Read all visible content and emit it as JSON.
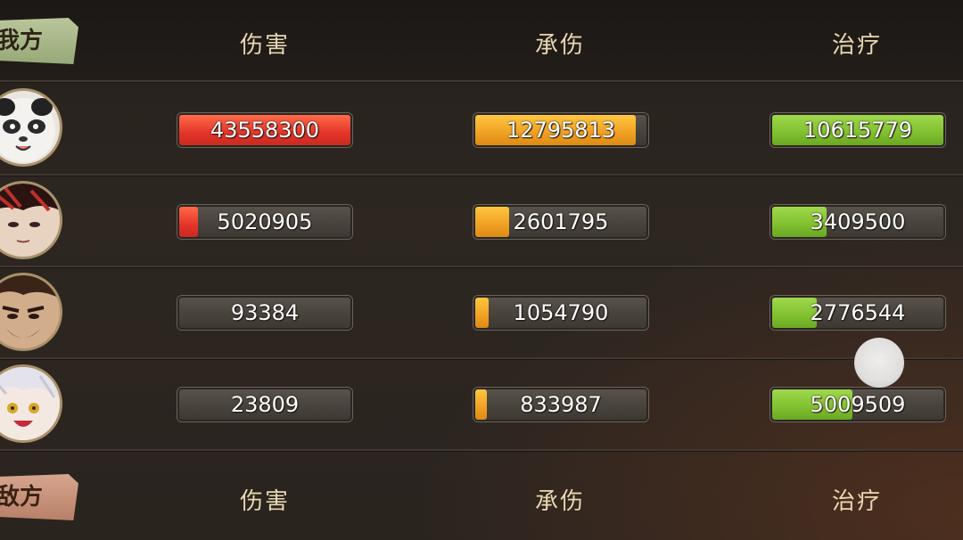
{
  "sections": {
    "friendly_label": "我方",
    "enemy_label": "敌方"
  },
  "columns": {
    "damage": "伤害",
    "taken": "承伤",
    "heal": "治疗"
  },
  "rows": [
    {
      "avatar_icon": "panda-character-icon",
      "damage": "43558300",
      "damage_fill": 1.0,
      "taken": "12795813",
      "taken_fill": 0.94,
      "heal": "10615779",
      "heal_fill": 1.0
    },
    {
      "avatar_icon": "red-haired-character-icon",
      "damage": "5020905",
      "damage_fill": 0.11,
      "taken": "2601795",
      "taken_fill": 0.2,
      "heal": "3409500",
      "heal_fill": 0.32
    },
    {
      "avatar_icon": "bearded-character-icon",
      "damage": "93384",
      "damage_fill": 0.0,
      "taken": "1054790",
      "taken_fill": 0.08,
      "heal": "2776544",
      "heal_fill": 0.26
    },
    {
      "avatar_icon": "white-haired-character-icon",
      "damage": "23809",
      "damage_fill": 0.0,
      "taken": "833987",
      "taken_fill": 0.07,
      "heal": "5009509",
      "heal_fill": 0.47
    }
  ],
  "colors": {
    "damage": "#e4342a",
    "taken": "#f0a024",
    "heal": "#80c02f"
  }
}
